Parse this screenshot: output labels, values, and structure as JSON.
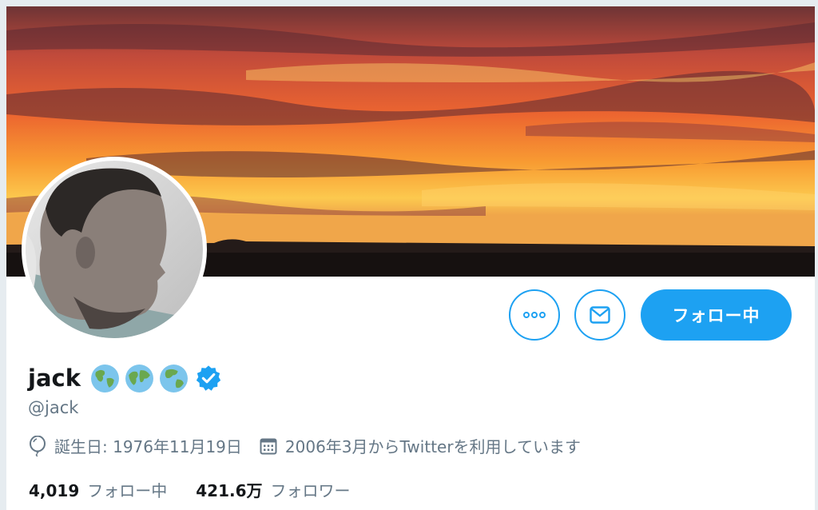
{
  "profile": {
    "name": "jack",
    "handle": "@jack",
    "birthday": "誕生日: 1976年11月19日",
    "joined": "2006年3月からTwitterを利用しています"
  },
  "actions": {
    "follow_label": "フォロー中"
  },
  "stats": {
    "following_count": "4,019",
    "following_label": "フォロー中",
    "followers_count": "421.6万",
    "followers_label": "フォロワー"
  },
  "colors": {
    "accent": "#1da1f2",
    "text_primary": "#14171a",
    "text_secondary": "#657786"
  },
  "icons": [
    "more-icon",
    "mail-icon",
    "globe-emoji-icon",
    "verified-badge-icon",
    "balloon-icon",
    "calendar-icon"
  ]
}
